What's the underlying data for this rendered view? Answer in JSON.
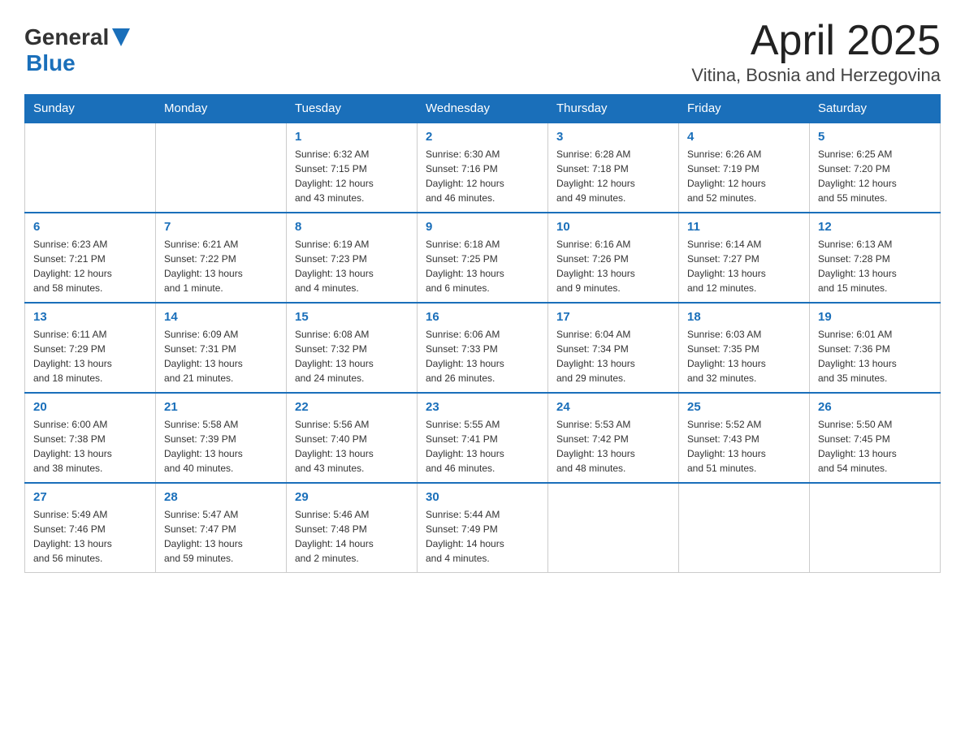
{
  "header": {
    "logo_general": "General",
    "logo_blue": "Blue",
    "title": "April 2025",
    "subtitle": "Vitina, Bosnia and Herzegovina"
  },
  "days_of_week": [
    "Sunday",
    "Monday",
    "Tuesday",
    "Wednesday",
    "Thursday",
    "Friday",
    "Saturday"
  ],
  "weeks": [
    [
      {
        "day": "",
        "info": ""
      },
      {
        "day": "",
        "info": ""
      },
      {
        "day": "1",
        "info": "Sunrise: 6:32 AM\nSunset: 7:15 PM\nDaylight: 12 hours\nand 43 minutes."
      },
      {
        "day": "2",
        "info": "Sunrise: 6:30 AM\nSunset: 7:16 PM\nDaylight: 12 hours\nand 46 minutes."
      },
      {
        "day": "3",
        "info": "Sunrise: 6:28 AM\nSunset: 7:18 PM\nDaylight: 12 hours\nand 49 minutes."
      },
      {
        "day": "4",
        "info": "Sunrise: 6:26 AM\nSunset: 7:19 PM\nDaylight: 12 hours\nand 52 minutes."
      },
      {
        "day": "5",
        "info": "Sunrise: 6:25 AM\nSunset: 7:20 PM\nDaylight: 12 hours\nand 55 minutes."
      }
    ],
    [
      {
        "day": "6",
        "info": "Sunrise: 6:23 AM\nSunset: 7:21 PM\nDaylight: 12 hours\nand 58 minutes."
      },
      {
        "day": "7",
        "info": "Sunrise: 6:21 AM\nSunset: 7:22 PM\nDaylight: 13 hours\nand 1 minute."
      },
      {
        "day": "8",
        "info": "Sunrise: 6:19 AM\nSunset: 7:23 PM\nDaylight: 13 hours\nand 4 minutes."
      },
      {
        "day": "9",
        "info": "Sunrise: 6:18 AM\nSunset: 7:25 PM\nDaylight: 13 hours\nand 6 minutes."
      },
      {
        "day": "10",
        "info": "Sunrise: 6:16 AM\nSunset: 7:26 PM\nDaylight: 13 hours\nand 9 minutes."
      },
      {
        "day": "11",
        "info": "Sunrise: 6:14 AM\nSunset: 7:27 PM\nDaylight: 13 hours\nand 12 minutes."
      },
      {
        "day": "12",
        "info": "Sunrise: 6:13 AM\nSunset: 7:28 PM\nDaylight: 13 hours\nand 15 minutes."
      }
    ],
    [
      {
        "day": "13",
        "info": "Sunrise: 6:11 AM\nSunset: 7:29 PM\nDaylight: 13 hours\nand 18 minutes."
      },
      {
        "day": "14",
        "info": "Sunrise: 6:09 AM\nSunset: 7:31 PM\nDaylight: 13 hours\nand 21 minutes."
      },
      {
        "day": "15",
        "info": "Sunrise: 6:08 AM\nSunset: 7:32 PM\nDaylight: 13 hours\nand 24 minutes."
      },
      {
        "day": "16",
        "info": "Sunrise: 6:06 AM\nSunset: 7:33 PM\nDaylight: 13 hours\nand 26 minutes."
      },
      {
        "day": "17",
        "info": "Sunrise: 6:04 AM\nSunset: 7:34 PM\nDaylight: 13 hours\nand 29 minutes."
      },
      {
        "day": "18",
        "info": "Sunrise: 6:03 AM\nSunset: 7:35 PM\nDaylight: 13 hours\nand 32 minutes."
      },
      {
        "day": "19",
        "info": "Sunrise: 6:01 AM\nSunset: 7:36 PM\nDaylight: 13 hours\nand 35 minutes."
      }
    ],
    [
      {
        "day": "20",
        "info": "Sunrise: 6:00 AM\nSunset: 7:38 PM\nDaylight: 13 hours\nand 38 minutes."
      },
      {
        "day": "21",
        "info": "Sunrise: 5:58 AM\nSunset: 7:39 PM\nDaylight: 13 hours\nand 40 minutes."
      },
      {
        "day": "22",
        "info": "Sunrise: 5:56 AM\nSunset: 7:40 PM\nDaylight: 13 hours\nand 43 minutes."
      },
      {
        "day": "23",
        "info": "Sunrise: 5:55 AM\nSunset: 7:41 PM\nDaylight: 13 hours\nand 46 minutes."
      },
      {
        "day": "24",
        "info": "Sunrise: 5:53 AM\nSunset: 7:42 PM\nDaylight: 13 hours\nand 48 minutes."
      },
      {
        "day": "25",
        "info": "Sunrise: 5:52 AM\nSunset: 7:43 PM\nDaylight: 13 hours\nand 51 minutes."
      },
      {
        "day": "26",
        "info": "Sunrise: 5:50 AM\nSunset: 7:45 PM\nDaylight: 13 hours\nand 54 minutes."
      }
    ],
    [
      {
        "day": "27",
        "info": "Sunrise: 5:49 AM\nSunset: 7:46 PM\nDaylight: 13 hours\nand 56 minutes."
      },
      {
        "day": "28",
        "info": "Sunrise: 5:47 AM\nSunset: 7:47 PM\nDaylight: 13 hours\nand 59 minutes."
      },
      {
        "day": "29",
        "info": "Sunrise: 5:46 AM\nSunset: 7:48 PM\nDaylight: 14 hours\nand 2 minutes."
      },
      {
        "day": "30",
        "info": "Sunrise: 5:44 AM\nSunset: 7:49 PM\nDaylight: 14 hours\nand 4 minutes."
      },
      {
        "day": "",
        "info": ""
      },
      {
        "day": "",
        "info": ""
      },
      {
        "day": "",
        "info": ""
      }
    ]
  ]
}
